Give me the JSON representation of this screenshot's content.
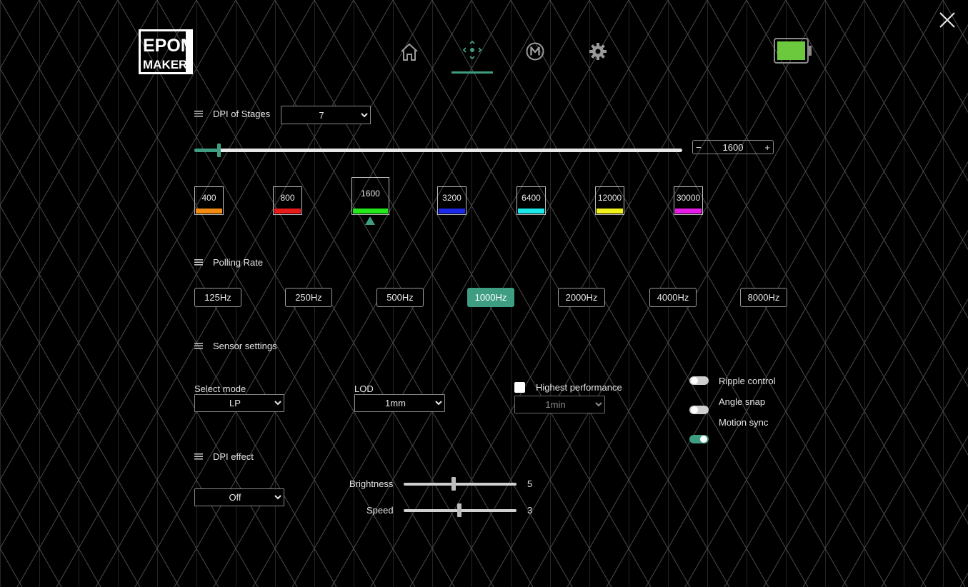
{
  "brand": {
    "logo_line1": "EPOM",
    "logo_line2": "MAKER"
  },
  "nav": {
    "items": [
      {
        "name": "home",
        "icon": "home-icon"
      },
      {
        "name": "dpi",
        "icon": "crosshair-icon",
        "active": true
      },
      {
        "name": "macro",
        "icon": "macro-m-icon"
      },
      {
        "name": "settings",
        "icon": "gear-icon"
      }
    ],
    "accent": "#3f9e82"
  },
  "battery": {
    "level": 1.0,
    "color": "#6cc83c"
  },
  "dpi_stages": {
    "title": "DPI of Stages",
    "stages_count": "7",
    "current_value": "1600",
    "slider_fraction": 0.05,
    "minus": "−",
    "plus": "+",
    "stages": [
      {
        "value": "400",
        "color": "#f08a10"
      },
      {
        "value": "800",
        "color": "#e81a1a"
      },
      {
        "value": "1600",
        "color": "#22e81a",
        "active": true
      },
      {
        "value": "3200",
        "color": "#1a2ae8"
      },
      {
        "value": "6400",
        "color": "#1ae8e8"
      },
      {
        "value": "12000",
        "color": "#f0f01a"
      },
      {
        "value": "30000",
        "color": "#e81ae8"
      }
    ]
  },
  "polling": {
    "title": "Polling Rate",
    "options": [
      "125Hz",
      "250Hz",
      "500Hz",
      "1000Hz",
      "2000Hz",
      "4000Hz",
      "8000Hz"
    ],
    "selected": "1000Hz"
  },
  "sensor": {
    "title": "Sensor settings",
    "select_mode_label": "Select mode",
    "select_mode_value": "LP",
    "lod_label": "LOD",
    "lod_value": "1mm",
    "highest_perf_label": "Highest performance",
    "highest_perf_checked": false,
    "highest_perf_value": "1min",
    "toggles": [
      {
        "label": "Ripple control",
        "on": false
      },
      {
        "label": "Angle snap",
        "on": false
      },
      {
        "label": "Motion sync",
        "on": true
      }
    ]
  },
  "dpi_effect": {
    "title": "DPI effect",
    "mode_value": "Off",
    "brightness_label": "Brightness",
    "brightness_value": "5",
    "speed_label": "Speed",
    "speed_value": "3"
  }
}
